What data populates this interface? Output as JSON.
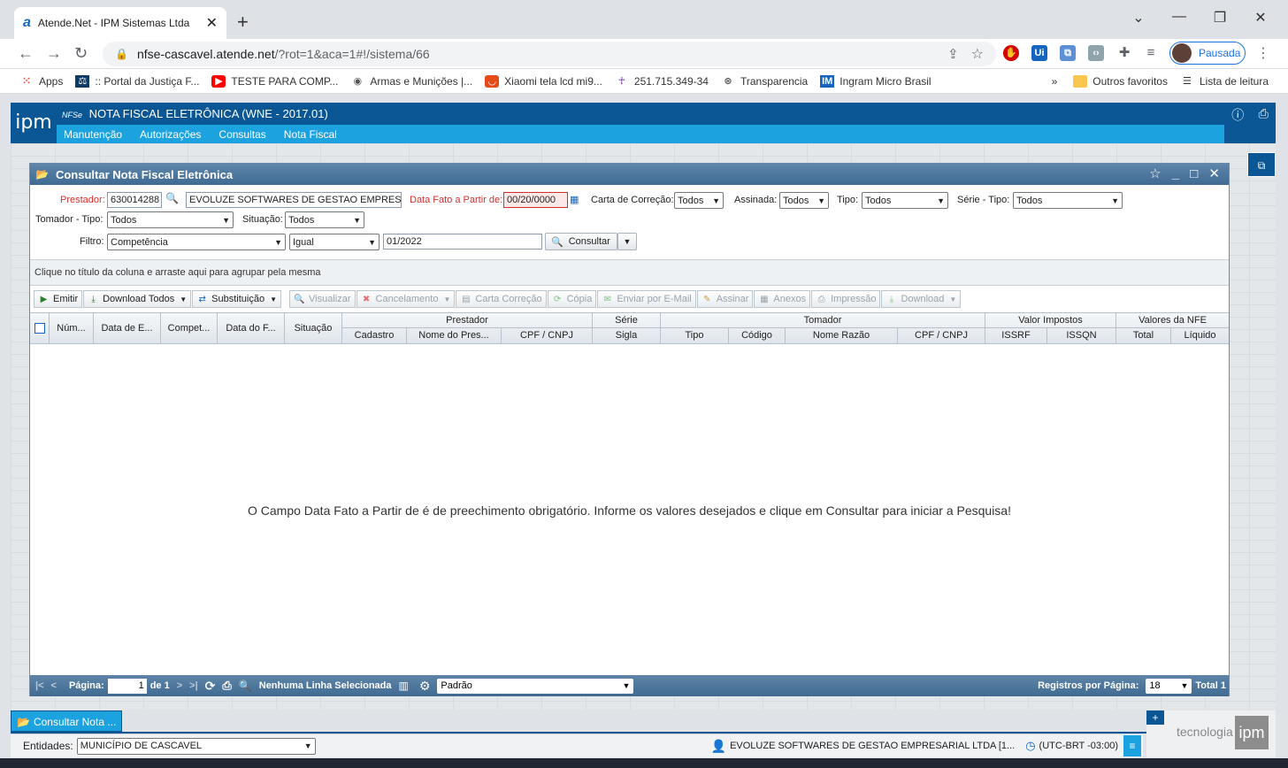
{
  "browser": {
    "tab_title": "Atende.Net - IPM Sistemas Ltda",
    "url_host": "nfse-cascavel.atende.net",
    "url_path": "/?rot=1&aca=1#!/sistema/66",
    "profile_label": "Pausada",
    "bookmarks": [
      "Apps",
      ":: Portal da Justiça F...",
      "TESTE PARA COMP...",
      "Armas e Munições |...",
      "Xiaomi tela lcd mi9...",
      "251.715.349-34",
      "Transparencia",
      "Ingram Micro Brasil"
    ],
    "bookmarks_more": "»",
    "other_favorites": "Outros favoritos",
    "reading_list": "Lista de leitura"
  },
  "app": {
    "logo": "ipm",
    "title_prefix": "NFSe",
    "title": "NOTA FISCAL ELETRÔNICA (WNE - 2017.01)",
    "menu": [
      "Manutenção",
      "Autorizações",
      "Consultas",
      "Nota Fiscal"
    ]
  },
  "window": {
    "title": "Consultar Nota Fiscal Eletrônica",
    "filters": {
      "prestador_label": "Prestador:",
      "prestador_code": "630014288",
      "prestador_name": "EVOLUZE SOFTWARES DE GESTAO EMPRESARIAL",
      "data_fato_label": "Data Fato a Partir de:",
      "data_fato_value": "00/20/0000",
      "carta_label": "Carta de Correção:",
      "carta_value": "Todos",
      "assinada_label": "Assinada:",
      "assinada_value": "Todos",
      "tipo_label": "Tipo:",
      "tipo_value": "Todos",
      "serie_label": "Série - Tipo:",
      "serie_value": "Todos",
      "tomador_label": "Tomador - Tipo:",
      "tomador_value": "Todos",
      "situacao_label": "Situação:",
      "situacao_value": "Todos",
      "filtro_label": "Filtro:",
      "filtro_field": "Competência",
      "filtro_op": "Igual",
      "filtro_value": "01/2022",
      "consultar": "Consultar"
    },
    "group_hint": "Clique no título da coluna e arraste aqui para agrupar pela mesma",
    "toolbar": {
      "emitir": "Emitir",
      "download_todos": "Download Todos",
      "substituicao": "Substituição",
      "visualizar": "Visualizar",
      "cancelamento": "Cancelamento",
      "carta_correcao": "Carta Correção",
      "copia": "Cópia",
      "enviar_email": "Enviar por E-Mail",
      "assinar": "Assinar",
      "anexos": "Anexos",
      "impressao": "Impressão",
      "download": "Download"
    },
    "columns": {
      "numero": "Núm...",
      "data_emissao": "Data de E...",
      "competencia": "Compet...",
      "data_fato": "Data do F...",
      "situacao": "Situação",
      "prestador": "Prestador",
      "cadastro": "Cadastro",
      "nome_prestador": "Nome do Pres...",
      "cpf_cnpj_prest": "CPF / CNPJ",
      "serie": "Série",
      "sigla": "Sigla",
      "tomador": "Tomador",
      "tipo": "Tipo",
      "codigo": "Código",
      "nome_razao": "Nome Razão",
      "cpf_cnpj_tom": "CPF / CNPJ",
      "valor_impostos": "Valor Impostos",
      "issrf": "ISSRF",
      "issqn": "ISSQN",
      "valores_nfe": "Valores da NFE",
      "total": "Total",
      "liquido": "Líquido"
    },
    "empty_message": "O Campo Data Fato a Partir de é de preechimento obrigatório. Informe os valores desejados e clique em Consultar para iniciar a Pesquisa!",
    "pager": {
      "pagina_label": "Página:",
      "pagina_value": "1",
      "de_label": "de 1",
      "selection": "Nenhuma Linha Selecionada",
      "layout": "Padrão",
      "registros_label": "Registros por Página:",
      "registros_value": "18",
      "total_label": "Total 1"
    }
  },
  "footer": {
    "task_tab": "Consultar Nota ...",
    "entidades_label": "Entidades:",
    "entidades_value": "MUNICÍPIO DE CASCAVEL",
    "user": "EVOLUZE SOFTWARES DE GESTAO EMPRESARIAL LTDA [1...",
    "timezone": "(UTC-BRT -03:00)",
    "brand_text": "tecnologia",
    "brand_logo": "ipm"
  },
  "colors": {
    "app_blue": "#0b5694",
    "menu_blue": "#1da2e0",
    "window_title": "#4a7399",
    "required_red": "#d32f2f"
  }
}
